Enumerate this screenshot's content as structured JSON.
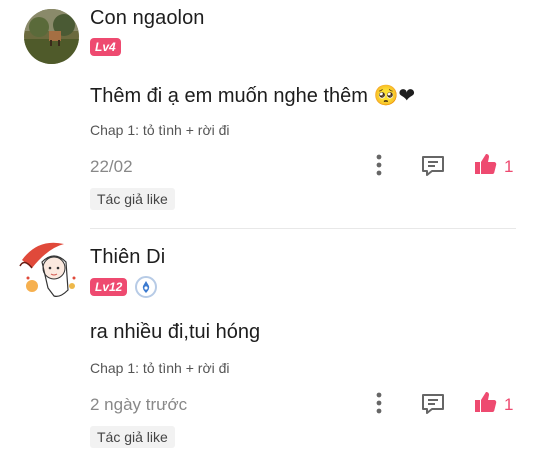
{
  "comments": [
    {
      "username": "Con ngaolon",
      "level": "Lv4",
      "text": "Thêm đi ạ em muốn nghe thêm 🥺❤",
      "chapter": "Chap 1: tỏ tình + rời đi",
      "time": "22/02",
      "likes": "1",
      "author_like": "Tác giả like"
    },
    {
      "username": "Thiên Di",
      "level": "Lv12",
      "text": "ra nhiều đi,tui hóng",
      "chapter": "Chap 1: tỏ tình + rời đi",
      "time": "2 ngày trước",
      "likes": "1",
      "author_like": "Tác giả like"
    }
  ],
  "colors": {
    "accent": "#ee4a70",
    "muted": "#888888"
  }
}
